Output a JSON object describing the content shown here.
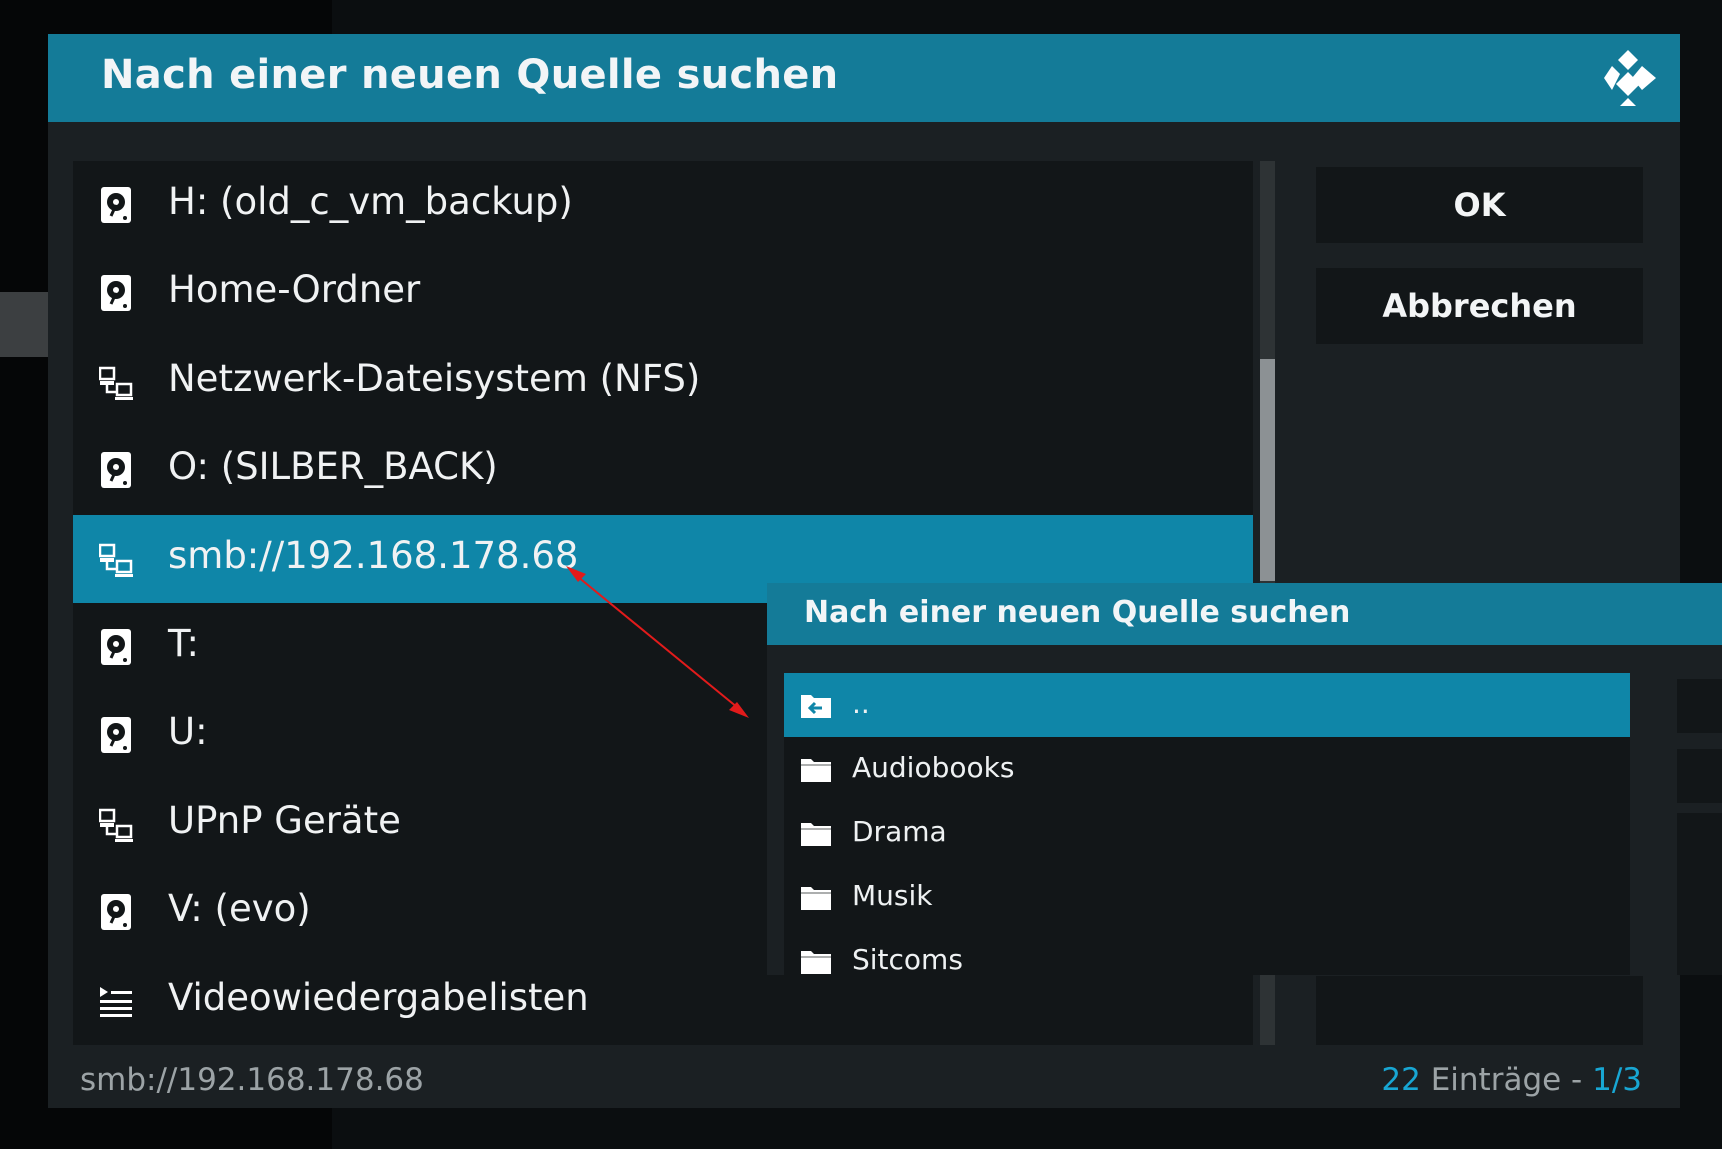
{
  "dialog": {
    "title": "Nach einer neuen Quelle suchen",
    "logo_icon": "kodi-logo-icon",
    "accent_color": "#147b98",
    "selection_color": "#0f86a8"
  },
  "sources": [
    {
      "label": "H: (old_c_vm_backup)",
      "icon": "hard-drive-icon"
    },
    {
      "label": "Home-Ordner",
      "icon": "hard-drive-icon"
    },
    {
      "label": "Netzwerk-Dateisystem (NFS)",
      "icon": "network-icon"
    },
    {
      "label": "O: (SILBER_BACK)",
      "icon": "hard-drive-icon"
    },
    {
      "label": "smb://192.168.178.68",
      "icon": "network-icon",
      "selected": true
    },
    {
      "label": "T:",
      "icon": "hard-drive-icon"
    },
    {
      "label": "U:",
      "icon": "hard-drive-icon"
    },
    {
      "label": "UPnP Geräte",
      "icon": "network-icon"
    },
    {
      "label": "V: (evo)",
      "icon": "hard-drive-icon"
    },
    {
      "label": "Videowiedergabelisten",
      "icon": "playlist-icon"
    }
  ],
  "buttons": {
    "ok": "OK",
    "cancel": "Abbrechen"
  },
  "footer": {
    "path": "smb://192.168.178.68",
    "count": "22",
    "count_label": " Einträge - ",
    "page": "1/3"
  },
  "inset": {
    "title": "Nach einer neuen Quelle suchen",
    "items": [
      {
        "label": "..",
        "icon": "folder-back-icon",
        "selected": true
      },
      {
        "label": "Audiobooks",
        "icon": "folder-icon"
      },
      {
        "label": "Drama",
        "icon": "folder-icon"
      },
      {
        "label": "Musik",
        "icon": "folder-icon"
      },
      {
        "label": "Sitcoms",
        "icon": "folder-icon"
      }
    ]
  },
  "annotation": {
    "arrow_color": "#e21b1b"
  }
}
